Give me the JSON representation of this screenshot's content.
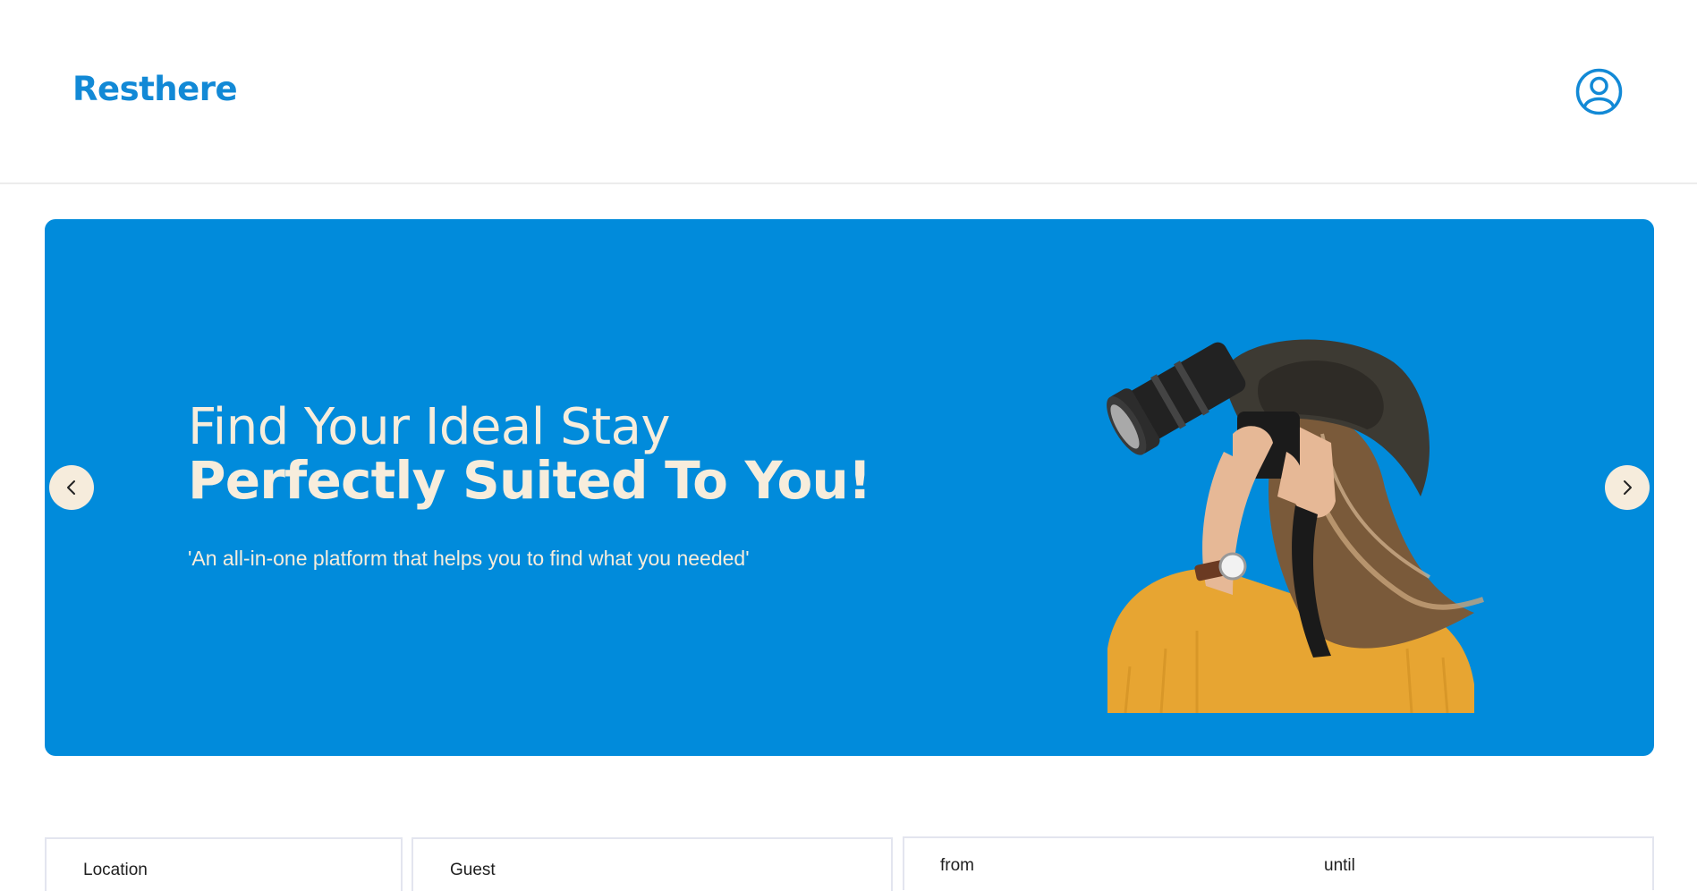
{
  "header": {
    "logo": "Resthere",
    "profile_icon": "user-circle-icon"
  },
  "colors": {
    "brand": "#1289d6",
    "hero_bg": "#018bdb",
    "hero_text": "#f7eddc",
    "carousel_button": "#f6ecdc"
  },
  "hero": {
    "title_line1": "Find Your Ideal Stay",
    "title_line2": "Perfectly Suited To You!",
    "subtitle": "'An all-in-one platform that helps you to find what you needed'",
    "image": "woman-with-camera-photo",
    "prev_icon": "chevron-left-icon",
    "next_icon": "chevron-right-icon"
  },
  "search": {
    "location_label": "Location",
    "guest_label": "Guest",
    "from_label": "from",
    "until_label": "until"
  }
}
